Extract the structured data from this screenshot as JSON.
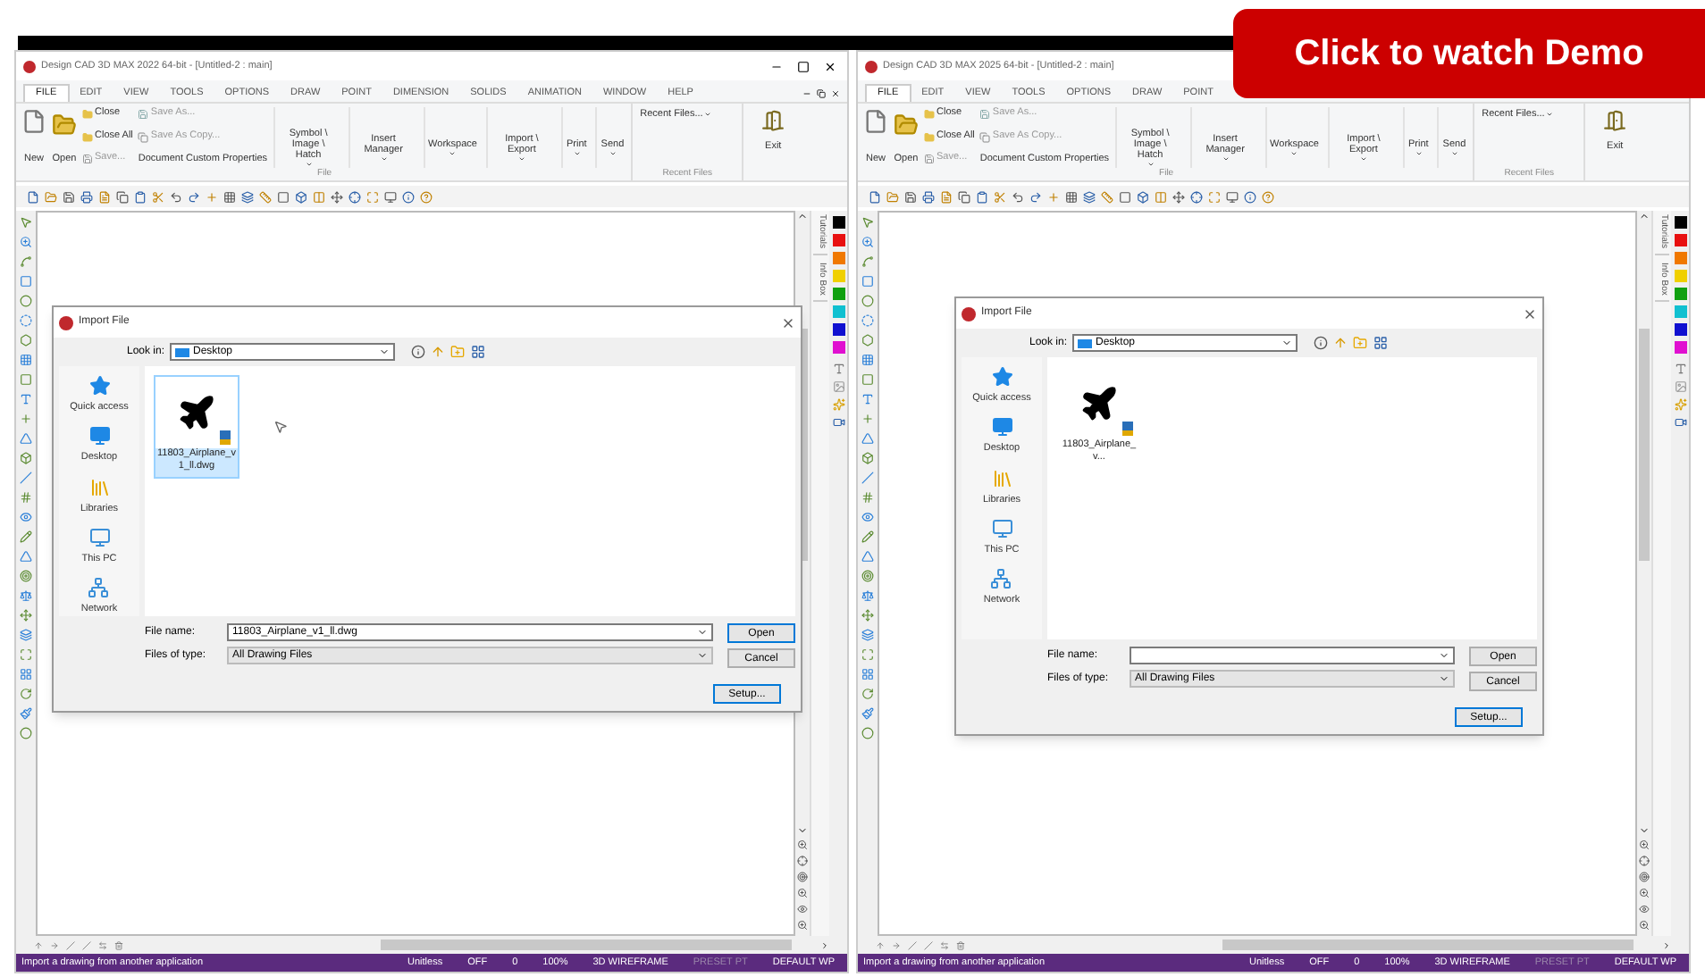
{
  "panes": [
    {
      "title": "Design CAD 3D MAX 2022 64-bit - [Untitled-2 : main]",
      "window_controls": true,
      "tabs": [
        {
          "label": "FILE",
          "selected": true
        },
        {
          "label": "EDIT",
          "selected": false
        },
        {
          "label": "VIEW",
          "selected": false
        },
        {
          "label": "TOOLS",
          "selected": false
        },
        {
          "label": "OPTIONS",
          "selected": false
        },
        {
          "label": "DRAW",
          "selected": false
        },
        {
          "label": "POINT",
          "selected": false
        },
        {
          "label": "DIMENSION",
          "selected": false
        },
        {
          "label": "SOLIDS",
          "selected": false
        },
        {
          "label": "ANIMATION",
          "selected": false
        },
        {
          "label": "WINDOW",
          "selected": false
        },
        {
          "label": "HELP",
          "selected": false
        }
      ],
      "ribbon": {
        "new": "New",
        "open": "Open",
        "close": "Close",
        "close_all": "Close All",
        "save": "Save...",
        "save_as": "Save As...",
        "save_as_copy": "Save As Copy...",
        "doc_props": "Document Custom Properties",
        "tools": [
          "Symbol \\ Image \\ Hatch",
          "Insert Manager",
          "Workspace",
          "Import \\ Export",
          "Print",
          "Send"
        ],
        "file_group": "File",
        "recent_files": "Recent Files...",
        "exit": "Exit",
        "recent_group": "Recent Files"
      },
      "side_tabs": [
        "Tutorials",
        "Info Box"
      ],
      "palette": [
        {
          "color": "#000000"
        },
        {
          "color": "#e81010"
        },
        {
          "color": "#f07800"
        },
        {
          "color": "#f0d000"
        },
        {
          "color": "#10a010"
        },
        {
          "color": "#10c0d0"
        },
        {
          "color": "#1010d0"
        },
        {
          "color": "#e010d0"
        }
      ],
      "dialog": {
        "title": "Import File",
        "look_in_label": "Look in:",
        "look_in": "Desktop",
        "places": [
          "Quick access",
          "Desktop",
          "Libraries",
          "This PC",
          "Network"
        ],
        "files": [
          {
            "name": "11803_Airplane_v1_ll.dwg",
            "selected": true
          }
        ],
        "file_name_label": "File name:",
        "file_name": "11803_Airplane_v1_ll.dwg",
        "file_type_label": "Files of type:",
        "file_type": "All Drawing Files",
        "buttons": [
          {
            "label": "Open",
            "focused": true
          },
          {
            "label": "Cancel",
            "focused": false
          },
          {
            "label": "Setup...",
            "focused": true
          }
        ]
      },
      "status": {
        "message": "Import a drawing from another application",
        "fields": [
          {
            "text": "Unitless",
            "disabled": false
          },
          {
            "text": "OFF",
            "disabled": false
          },
          {
            "text": "0",
            "disabled": false
          },
          {
            "text": "100%",
            "disabled": false
          },
          {
            "text": "3D WIREFRAME",
            "disabled": false
          },
          {
            "text": "PRESET PT",
            "disabled": true
          },
          {
            "text": "DEFAULT WP",
            "disabled": false
          }
        ]
      }
    },
    {
      "title": "Design CAD 3D MAX 2025 64-bit - [Untitled-2 : main]",
      "window_controls": false,
      "tabs": [
        {
          "label": "FILE",
          "selected": true
        },
        {
          "label": "EDIT",
          "selected": false
        },
        {
          "label": "VIEW",
          "selected": false
        },
        {
          "label": "TOOLS",
          "selected": false
        },
        {
          "label": "OPTIONS",
          "selected": false
        },
        {
          "label": "DRAW",
          "selected": false
        },
        {
          "label": "POINT",
          "selected": false
        }
      ],
      "ribbon": {
        "new": "New",
        "open": "Open",
        "close": "Close",
        "close_all": "Close All",
        "save": "Save...",
        "save_as": "Save As...",
        "save_as_copy": "Save As Copy...",
        "doc_props": "Document Custom Properties",
        "tools": [
          "Symbol \\ Image \\ Hatch",
          "Insert Manager",
          "Workspace",
          "Import \\ Export",
          "Print",
          "Send"
        ],
        "file_group": "File",
        "recent_files": "Recent Files...",
        "exit": "Exit",
        "recent_group": "Recent Files"
      },
      "side_tabs": [
        "Tutorials",
        "Info Box"
      ],
      "palette": [
        {
          "color": "#000000"
        },
        {
          "color": "#e81010"
        },
        {
          "color": "#f07800"
        },
        {
          "color": "#f0d000"
        },
        {
          "color": "#10a010"
        },
        {
          "color": "#10c0d0"
        },
        {
          "color": "#1010d0"
        },
        {
          "color": "#e010d0"
        }
      ],
      "dialog": {
        "title": "Import File",
        "look_in_label": "Look in:",
        "look_in": "Desktop",
        "places": [
          "Quick access",
          "Desktop",
          "Libraries",
          "This PC",
          "Network"
        ],
        "files": [
          {
            "name": "11803_Airplane_v...",
            "selected": false
          }
        ],
        "file_name_label": "File name:",
        "file_type_label": "Files of type:",
        "file_type": "All Drawing Files",
        "buttons": [
          {
            "label": "Open",
            "focused": false
          },
          {
            "label": "Cancel",
            "focused": false
          },
          {
            "label": "Setup...",
            "focused": true
          }
        ]
      },
      "status": {
        "message": "Import a drawing from another application",
        "fields": [
          {
            "text": "Unitless",
            "disabled": false
          },
          {
            "text": "OFF",
            "disabled": false
          },
          {
            "text": "0",
            "disabled": false
          },
          {
            "text": "100%",
            "disabled": false
          },
          {
            "text": "3D WIREFRAME",
            "disabled": false
          },
          {
            "text": "PRESET PT",
            "disabled": true
          },
          {
            "text": "DEFAULT WP",
            "disabled": false
          }
        ]
      }
    }
  ],
  "demo_banner": {
    "label": "Click to watch Demo"
  }
}
